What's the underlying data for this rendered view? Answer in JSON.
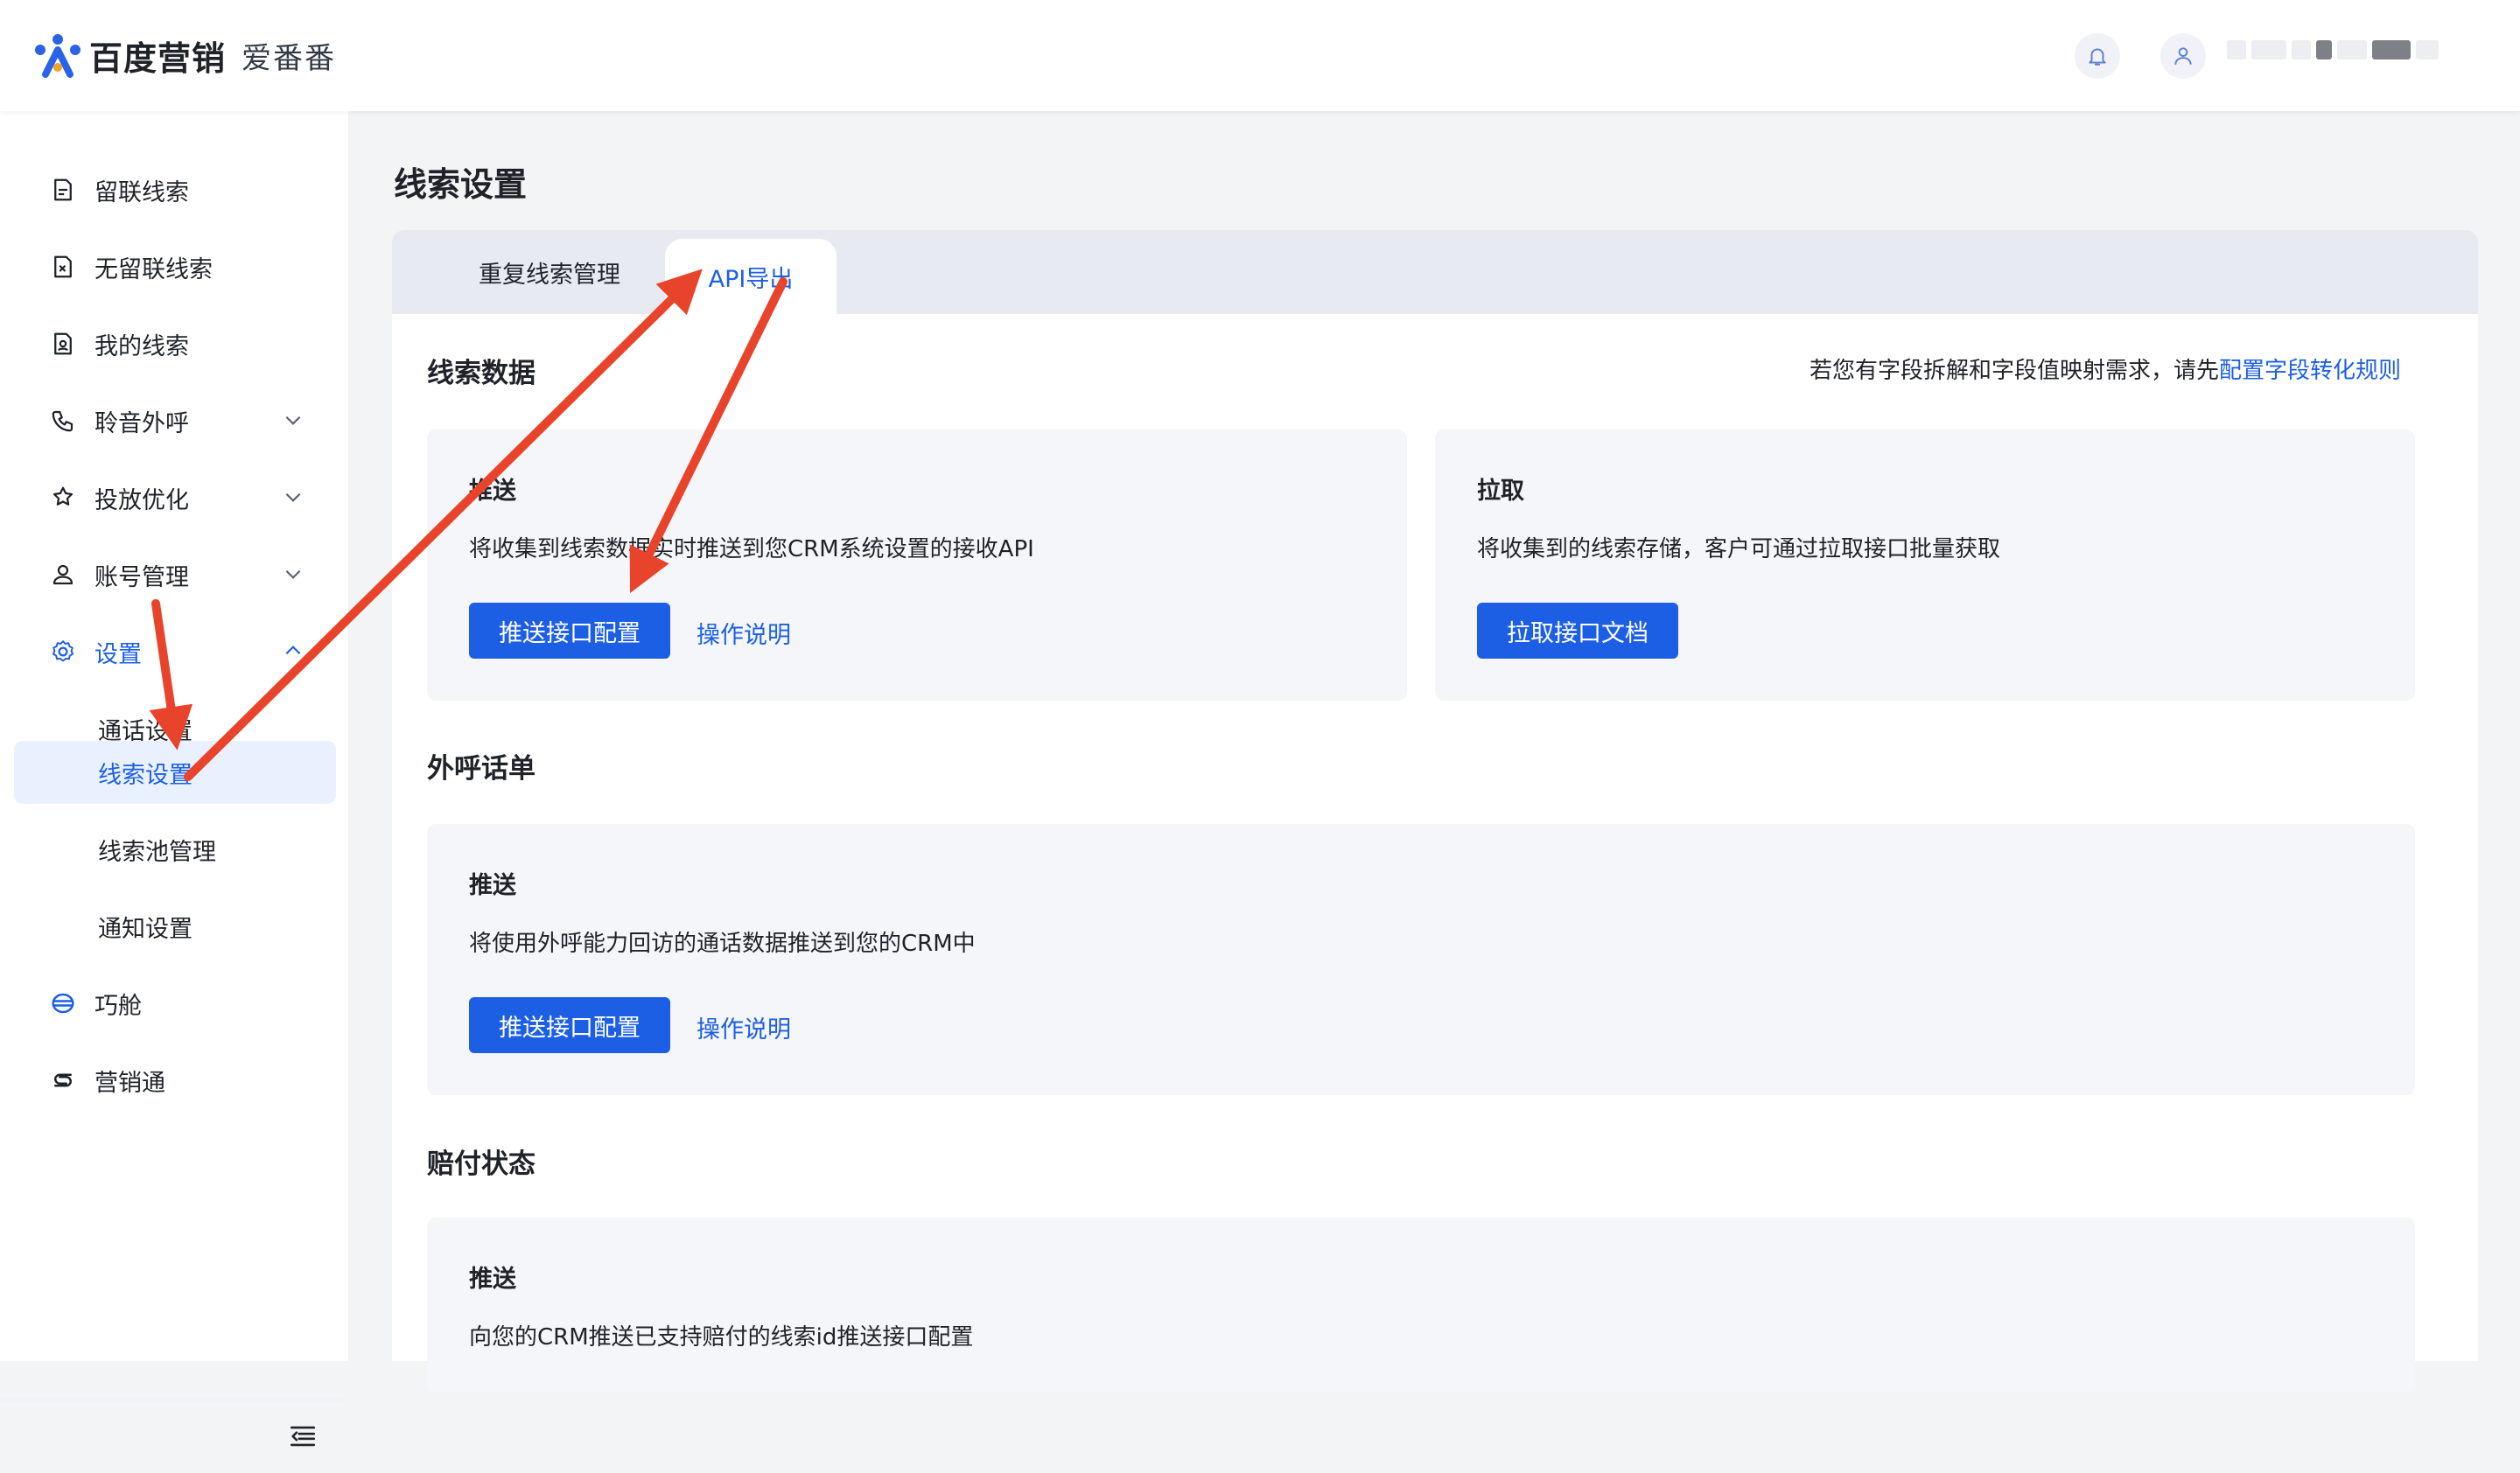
{
  "header": {
    "brand": "百度营销",
    "product": "爱番番",
    "icons": [
      "bell-icon",
      "user-icon"
    ]
  },
  "sidebar": {
    "items": [
      {
        "label": "留联线索",
        "icon": "clue-doc-icon"
      },
      {
        "label": "无留联线索",
        "icon": "clue-x-icon"
      },
      {
        "label": "我的线索",
        "icon": "my-clue-icon"
      },
      {
        "label": "聆音外呼",
        "icon": "phone-icon",
        "expandable": true
      },
      {
        "label": "投放优化",
        "icon": "star-gear-icon",
        "expandable": true
      },
      {
        "label": "账号管理",
        "icon": "account-icon",
        "expandable": true
      },
      {
        "label": "设置",
        "icon": "gear-icon",
        "expandable": true,
        "expanded": true
      },
      {
        "label": "通话设置",
        "sub": true
      },
      {
        "label": "线索设置",
        "sub": true,
        "selected": true
      },
      {
        "label": "线索池管理",
        "sub": true
      },
      {
        "label": "通知设置",
        "sub": true
      },
      {
        "label": "巧舱",
        "icon": "qiaocang-icon"
      },
      {
        "label": "营销通",
        "icon": "yingxiaotong-icon"
      }
    ]
  },
  "page": {
    "title": "线索设置",
    "tabs": [
      {
        "label": "重复线索管理",
        "active": false
      },
      {
        "label": "API导出",
        "active": true
      }
    ]
  },
  "clue_data": {
    "title": "线索数据",
    "hint_prefix": "若您有字段拆解和字段值映射需求，请先",
    "hint_link": "配置字段转化规则",
    "push": {
      "title": "推送",
      "desc": "将收集到线索数据实时推送到您CRM系统设置的接收API",
      "button": "推送接口配置",
      "link": "操作说明"
    },
    "pull": {
      "title": "拉取",
      "desc": "将收集到的线索存储，客户可通过拉取接口批量获取",
      "button": "拉取接口文档"
    }
  },
  "call_records": {
    "title": "外呼话单",
    "push": {
      "title": "推送",
      "desc": "将使用外呼能力回访的通话数据推送到您的CRM中",
      "button": "推送接口配置",
      "link": "操作说明"
    }
  },
  "compensation": {
    "title": "赔付状态",
    "push": {
      "title": "推送",
      "desc": "向您的CRM推送已支持赔付的线索id推送接口配置"
    }
  },
  "colors": {
    "primary": "#1d5fe4",
    "annotation_arrow": "#e8442b",
    "card_bg": "#f5f6f9",
    "tab_bar_bg": "#e7eaf0"
  }
}
